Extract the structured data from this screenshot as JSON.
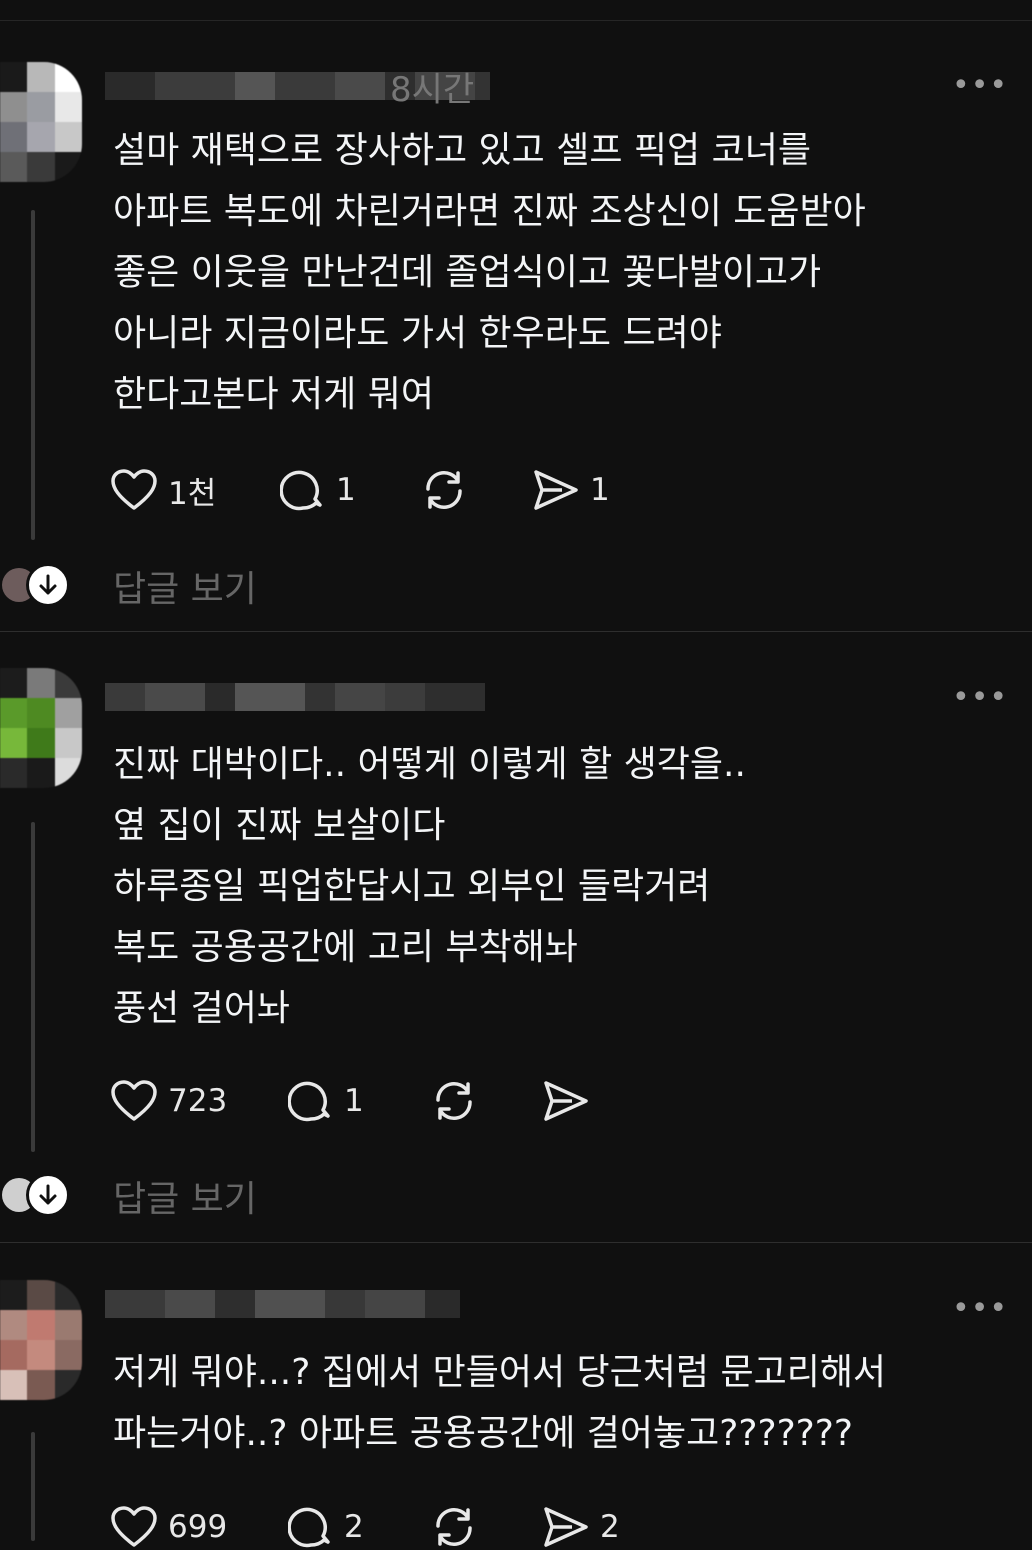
{
  "posts": [
    {
      "time": "8시간",
      "more": "•••",
      "text": "설마 재택으로 장사하고 있고 셀프 픽업 코너를\n아파트 복도에 차린거라면 진짜 조상신이 도움받아\n좋은 이웃을 만난건데 졸업식이고 꽃다발이고가\n아니라 지금이라도 가서 한우라도 드려야\n한다고본다 저게 뭐여",
      "likes": "1천",
      "comments": "1",
      "shares": "1",
      "view_replies": "답글 보기"
    },
    {
      "time": "",
      "more": "•••",
      "text": "진짜 대박이다.. 어떻게 이렇게 할 생각을..\n옆 집이 진짜 보살이다\n하루종일 픽업한답시고 외부인 들락거려\n복도 공용공간에 고리 부착해놔\n풍선 걸어놔",
      "likes": "723",
      "comments": "1",
      "shares": "",
      "view_replies": "답글 보기"
    },
    {
      "time": "",
      "more": "•••",
      "text": "저게 뭐야...? 집에서 만들어서 당근처럼 문고리해서\n파는거야..? 아파트 공용공간에 걸어놓고???????",
      "likes": "699",
      "comments": "2",
      "shares": "2"
    }
  ]
}
